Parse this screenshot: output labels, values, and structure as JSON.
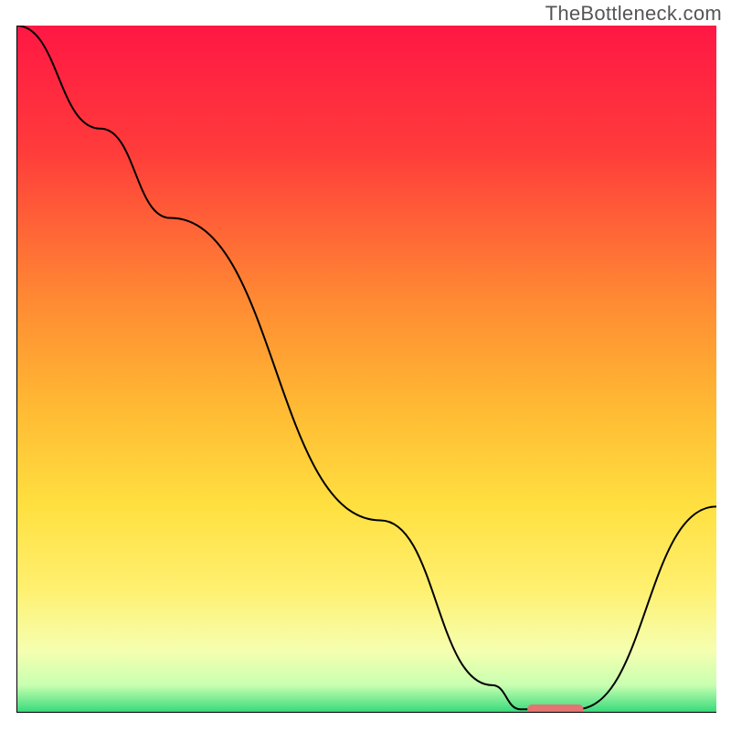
{
  "watermark": "TheBottleneck.com",
  "chart_data": {
    "type": "line",
    "title": "",
    "xlabel": "",
    "ylabel": "",
    "xlim": [
      0,
      100
    ],
    "ylim": [
      0,
      100
    ],
    "grid": false,
    "legend": false,
    "background_gradient": [
      {
        "offset": 0,
        "color": "#ff1744"
      },
      {
        "offset": 18,
        "color": "#ff3b3b"
      },
      {
        "offset": 40,
        "color": "#ff8a33"
      },
      {
        "offset": 55,
        "color": "#ffb833"
      },
      {
        "offset": 70,
        "color": "#ffe040"
      },
      {
        "offset": 82,
        "color": "#fff070"
      },
      {
        "offset": 91,
        "color": "#f5ffb0"
      },
      {
        "offset": 96,
        "color": "#c8ffb0"
      },
      {
        "offset": 100,
        "color": "#33d97a"
      }
    ],
    "series": [
      {
        "name": "bottleneck-curve",
        "color": "#000000",
        "width": 0.35,
        "points": [
          {
            "x": 0,
            "y": 100
          },
          {
            "x": 12,
            "y": 85
          },
          {
            "x": 22,
            "y": 72
          },
          {
            "x": 52,
            "y": 28
          },
          {
            "x": 68,
            "y": 4
          },
          {
            "x": 72,
            "y": 0.5
          },
          {
            "x": 80,
            "y": 0.5
          },
          {
            "x": 100,
            "y": 30
          }
        ]
      }
    ],
    "marker": {
      "name": "target-marker",
      "color": "#e57373",
      "x_start": 73,
      "x_end": 81,
      "y": 0.5,
      "height": 1.4
    },
    "axis": {
      "color": "#000000",
      "width": 0.3
    }
  }
}
